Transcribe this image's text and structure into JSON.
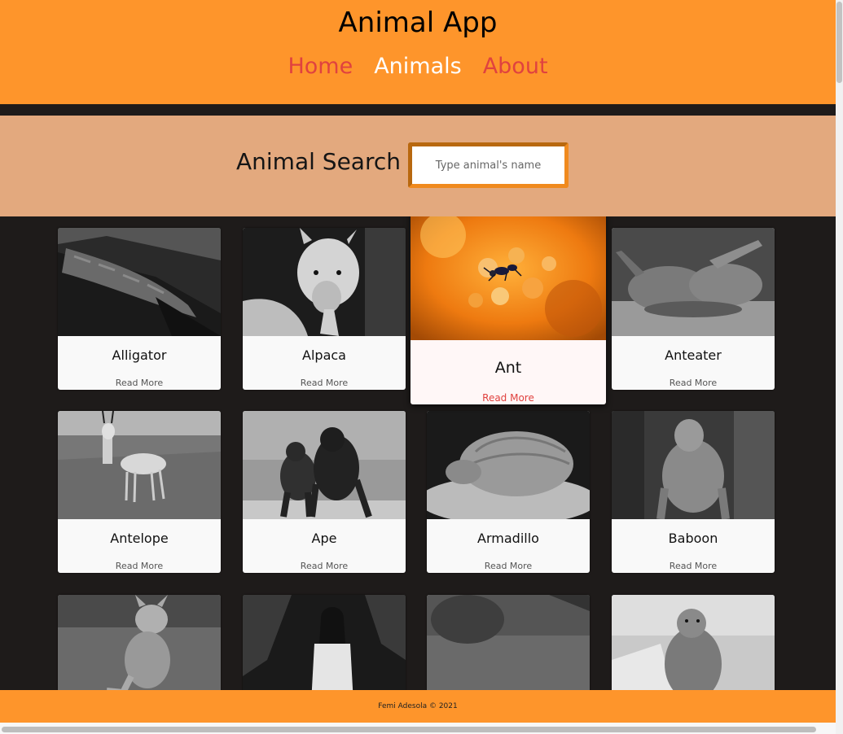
{
  "header": {
    "title": "Animal App",
    "nav": [
      {
        "label": "Home",
        "active": false
      },
      {
        "label": "Animals",
        "active": true
      },
      {
        "label": "About",
        "active": false
      }
    ]
  },
  "search": {
    "label": "Animal Search",
    "placeholder": "Type animal's name",
    "value": ""
  },
  "cards": [
    {
      "name": "Alligator",
      "more": "Read More",
      "photo": "alligator-photo"
    },
    {
      "name": "Alpaca",
      "more": "Read More",
      "photo": "alpaca-photo"
    },
    {
      "name": "Ant",
      "more": "Read More",
      "photo": "ant-photo",
      "featured": true
    },
    {
      "name": "Anteater",
      "more": "Read More",
      "photo": "anteater-photo"
    },
    {
      "name": "Antelope",
      "more": "Read More",
      "photo": "antelope-photo"
    },
    {
      "name": "Ape",
      "more": "Read More",
      "photo": "ape-photo"
    },
    {
      "name": "Armadillo",
      "more": "Read More",
      "photo": "armadillo-photo"
    },
    {
      "name": "Baboon",
      "more": "Read More",
      "photo": "baboon-photo"
    },
    {
      "name": "",
      "more": "",
      "photo": "fox-photo"
    },
    {
      "name": "",
      "more": "",
      "photo": "woman-photo"
    },
    {
      "name": "",
      "more": "",
      "photo": "animal-on-grass-photo"
    },
    {
      "name": "",
      "more": "",
      "photo": "marmot-photo"
    }
  ],
  "footer": {
    "text": "Femi Adesola © 2021"
  },
  "colors": {
    "brand_orange": "#fe952b",
    "search_band": "#e3a97e",
    "background_dark": "#1e1b1a",
    "nav_link": "#e0423f",
    "nav_active": "#ffffff"
  }
}
